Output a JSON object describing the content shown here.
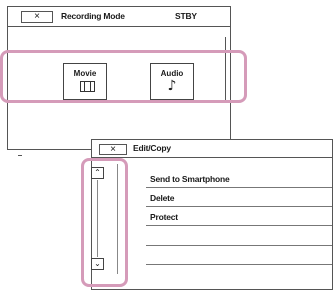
{
  "recording_mode": {
    "close_label": "×",
    "title": "Recording Mode",
    "status": "STBY",
    "modes": [
      {
        "label": "Movie",
        "icon": "film-icon"
      },
      {
        "label": "Audio",
        "icon": "music-note-icon",
        "glyph": "♪"
      }
    ]
  },
  "edit_copy": {
    "close_label": "×",
    "title": "Edit/Copy",
    "items": [
      "Send to Smartphone",
      "Delete",
      "Protect"
    ],
    "scroll_up": "⌃",
    "scroll_down": "⌄"
  },
  "colors": {
    "highlight": "#d59bb9"
  }
}
